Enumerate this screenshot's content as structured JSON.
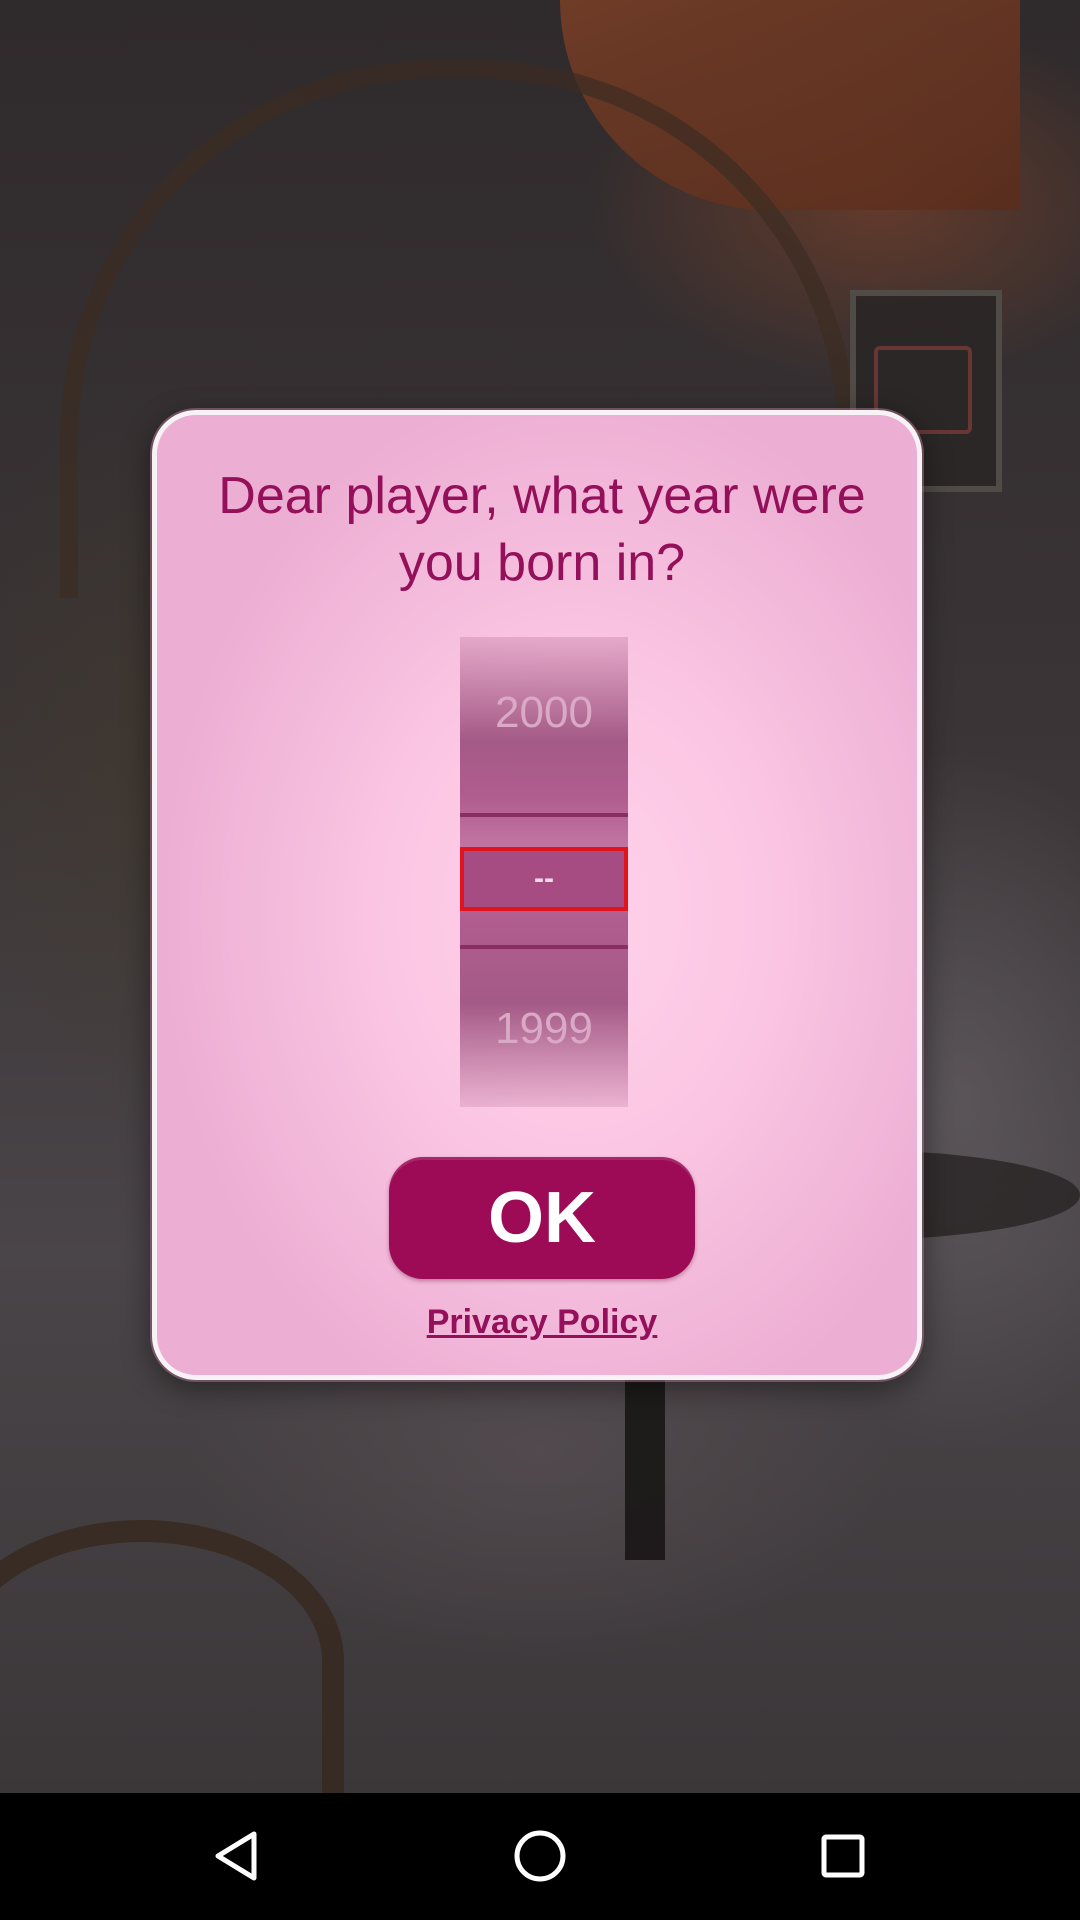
{
  "dialog": {
    "title": "Dear player, what year were you born in?",
    "year_picker": {
      "option_above": "2000",
      "selected": "--",
      "option_below": "1999"
    },
    "ok_label": "OK",
    "privacy_label": "Privacy Policy"
  },
  "nav_bar": {
    "buttons": [
      "back",
      "home",
      "recents"
    ]
  },
  "colors": {
    "accent": "#9d0a55",
    "dialog_background": "#fbc6e3",
    "selection_border": "#e0141e"
  }
}
